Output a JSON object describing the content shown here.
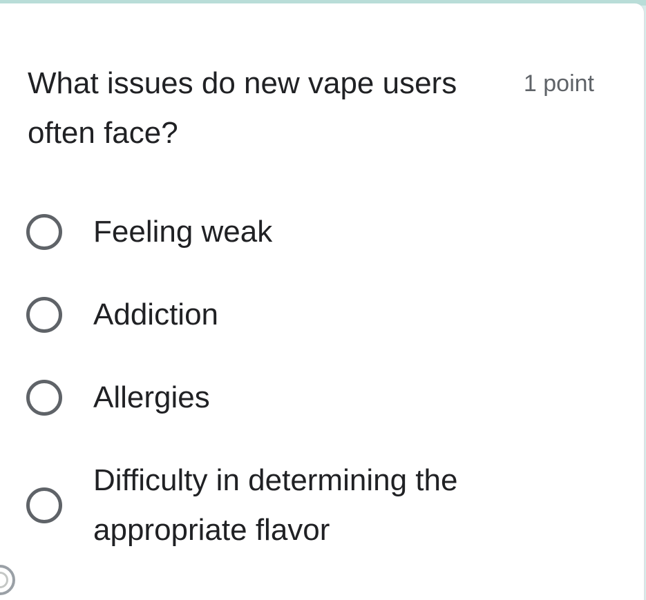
{
  "question": {
    "title": "What issues do new vape users often face?",
    "points": "1 point"
  },
  "options": [
    {
      "label": "Feeling weak",
      "selected": false
    },
    {
      "label": "Addiction",
      "selected": false
    },
    {
      "label": "Allergies",
      "selected": false
    },
    {
      "label": "Difficulty in determining the appropriate flavor",
      "selected": false
    }
  ],
  "colors": {
    "background_accent": "#b9ddd8",
    "radio_border": "#5f6368",
    "text": "#202124",
    "points_text": "#5f6368"
  },
  "icons": {
    "option_radio": "radio-unchecked-icon",
    "corner": "partial-circle-icon"
  }
}
